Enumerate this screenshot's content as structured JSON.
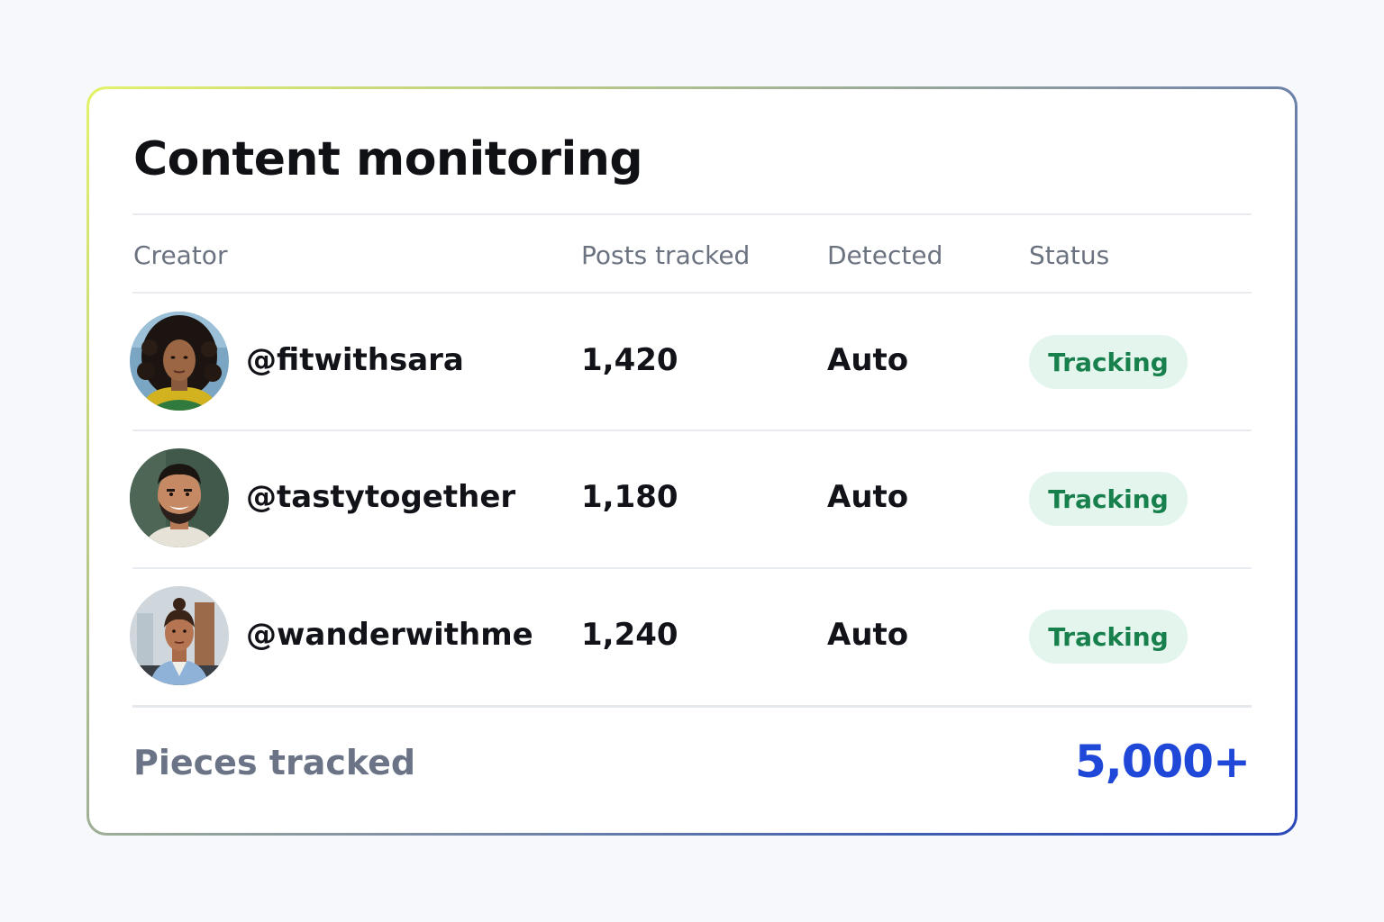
{
  "card": {
    "title": "Content monitoring"
  },
  "table": {
    "headers": {
      "creator": "Creator",
      "posts": "Posts tracked",
      "detected": "Detected",
      "status": "Status"
    },
    "rows": [
      {
        "handle": "@fitwithsara",
        "posts": "1,420",
        "detected": "Auto",
        "status": "Tracking"
      },
      {
        "handle": "@tastytogether",
        "posts": "1,180",
        "detected": "Auto",
        "status": "Tracking"
      },
      {
        "handle": "@wanderwithme",
        "posts": "1,240",
        "detected": "Auto",
        "status": "Tracking"
      }
    ]
  },
  "footer": {
    "label": "Pieces tracked",
    "value": "5,000+"
  },
  "colors": {
    "accent": "#1f47d8",
    "status_text": "#17804c",
    "status_bg": "#e3f5ec"
  }
}
